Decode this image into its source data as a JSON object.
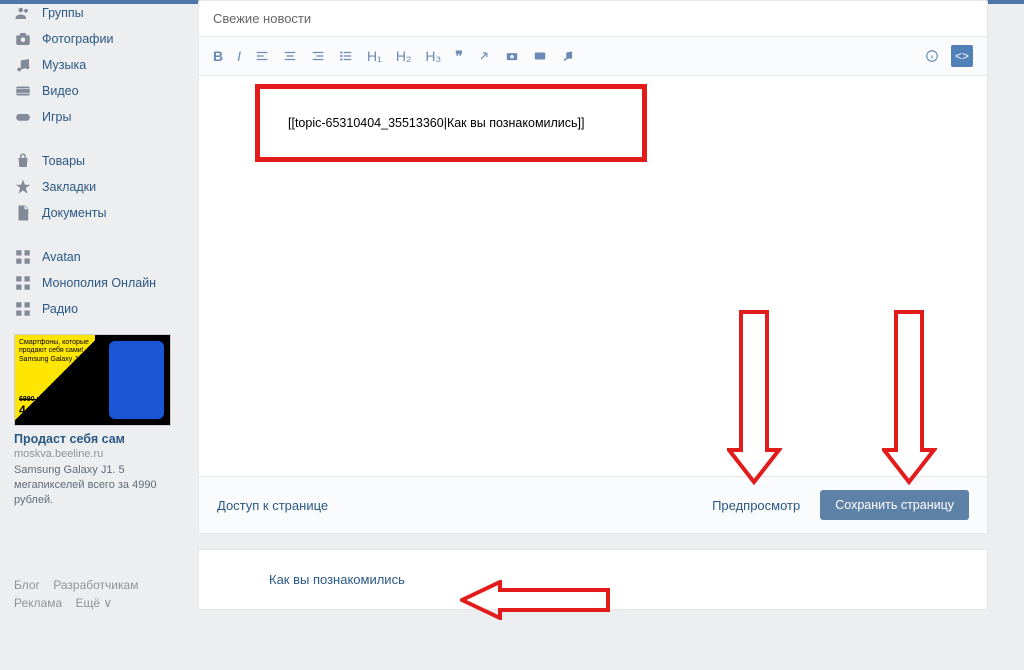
{
  "sidebar": {
    "nav1": [
      {
        "icon": "groups",
        "label": "Группы"
      },
      {
        "icon": "photos",
        "label": "Фотографии"
      },
      {
        "icon": "music",
        "label": "Музыка"
      },
      {
        "icon": "video",
        "label": "Видео"
      },
      {
        "icon": "games",
        "label": "Игры"
      }
    ],
    "nav2": [
      {
        "icon": "market",
        "label": "Товары"
      },
      {
        "icon": "bookmarks",
        "label": "Закладки"
      },
      {
        "icon": "docs",
        "label": "Документы"
      }
    ],
    "nav3": [
      {
        "icon": "app",
        "label": "Avatan"
      },
      {
        "icon": "app",
        "label": "Монополия Онлайн"
      },
      {
        "icon": "app",
        "label": "Радио"
      }
    ]
  },
  "ad": {
    "text_lines": "Смартфоны, которые\nпродают себя сами!\nSamsung Galaxy J1 | 4G",
    "old_price": "6990 руб.",
    "price": "4 990 руб.",
    "title": "Продаст себя сам",
    "domain": "moskva.beeline.ru",
    "desc": "Samsung Galaxy J1. 5 мегапикселей всего за 4990 рублей."
  },
  "footer": {
    "blog": "Блог",
    "devs": "Разработчикам",
    "ads": "Реклама",
    "more": "Ещё"
  },
  "editor": {
    "title": "Свежие новости",
    "code_string": "[[topic-65310404_35513360|Как вы познакомились]]"
  },
  "action_bar": {
    "access": "Доступ к странице",
    "preview": "Предпросмотр",
    "save": "Сохранить страницу"
  },
  "result": {
    "link": "Как вы познакомились"
  },
  "toolbar_headers": {
    "h1": "H₁",
    "h2": "H₂",
    "h3": "H₃"
  }
}
